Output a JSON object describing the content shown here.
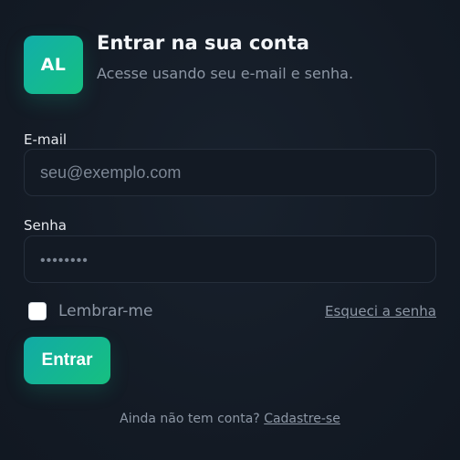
{
  "brand": {
    "logo_text": "AL",
    "accent_start": "#12aeaa",
    "accent_end": "#15c081"
  },
  "header": {
    "title": "Entrar na sua conta",
    "subtitle": "Acesse usando seu e-mail e senha."
  },
  "form": {
    "email_label": "E-mail",
    "email_placeholder": "seu@exemplo.com",
    "password_label": "Senha",
    "password_placeholder": "••••••••",
    "remember_label": "Lembrar-me",
    "remember_checked": false,
    "forgot_link": "Esqueci a senha",
    "submit_label": "Entrar"
  },
  "footer": {
    "prompt": "Ainda não tem conta?",
    "signup_link": "Cadastre-se"
  }
}
